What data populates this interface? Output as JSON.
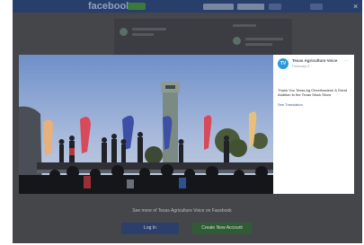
{
  "topbar": {
    "logo": "facebook",
    "close_symbol": "×"
  },
  "viewer": {
    "page_avatar_text": "TV",
    "page_name": "Texas Agriculture Voice",
    "page_link_text": "... more",
    "post_time": "February 2 · ",
    "caption_prefix": "",
    "caption_text": "Thank You Texas Ag Cheerleaders! A Great Addition to the Texas Stock Show",
    "see_more": "See Translation"
  },
  "footer": {
    "message": "See more of Texas Agriculture Voice on Facebook",
    "login_label": "Log In",
    "signup_label": "Create New Account"
  },
  "colors": {
    "facebook_blue": "#283f6c",
    "link_blue": "#365899",
    "signup_green": "#2f5c34"
  }
}
